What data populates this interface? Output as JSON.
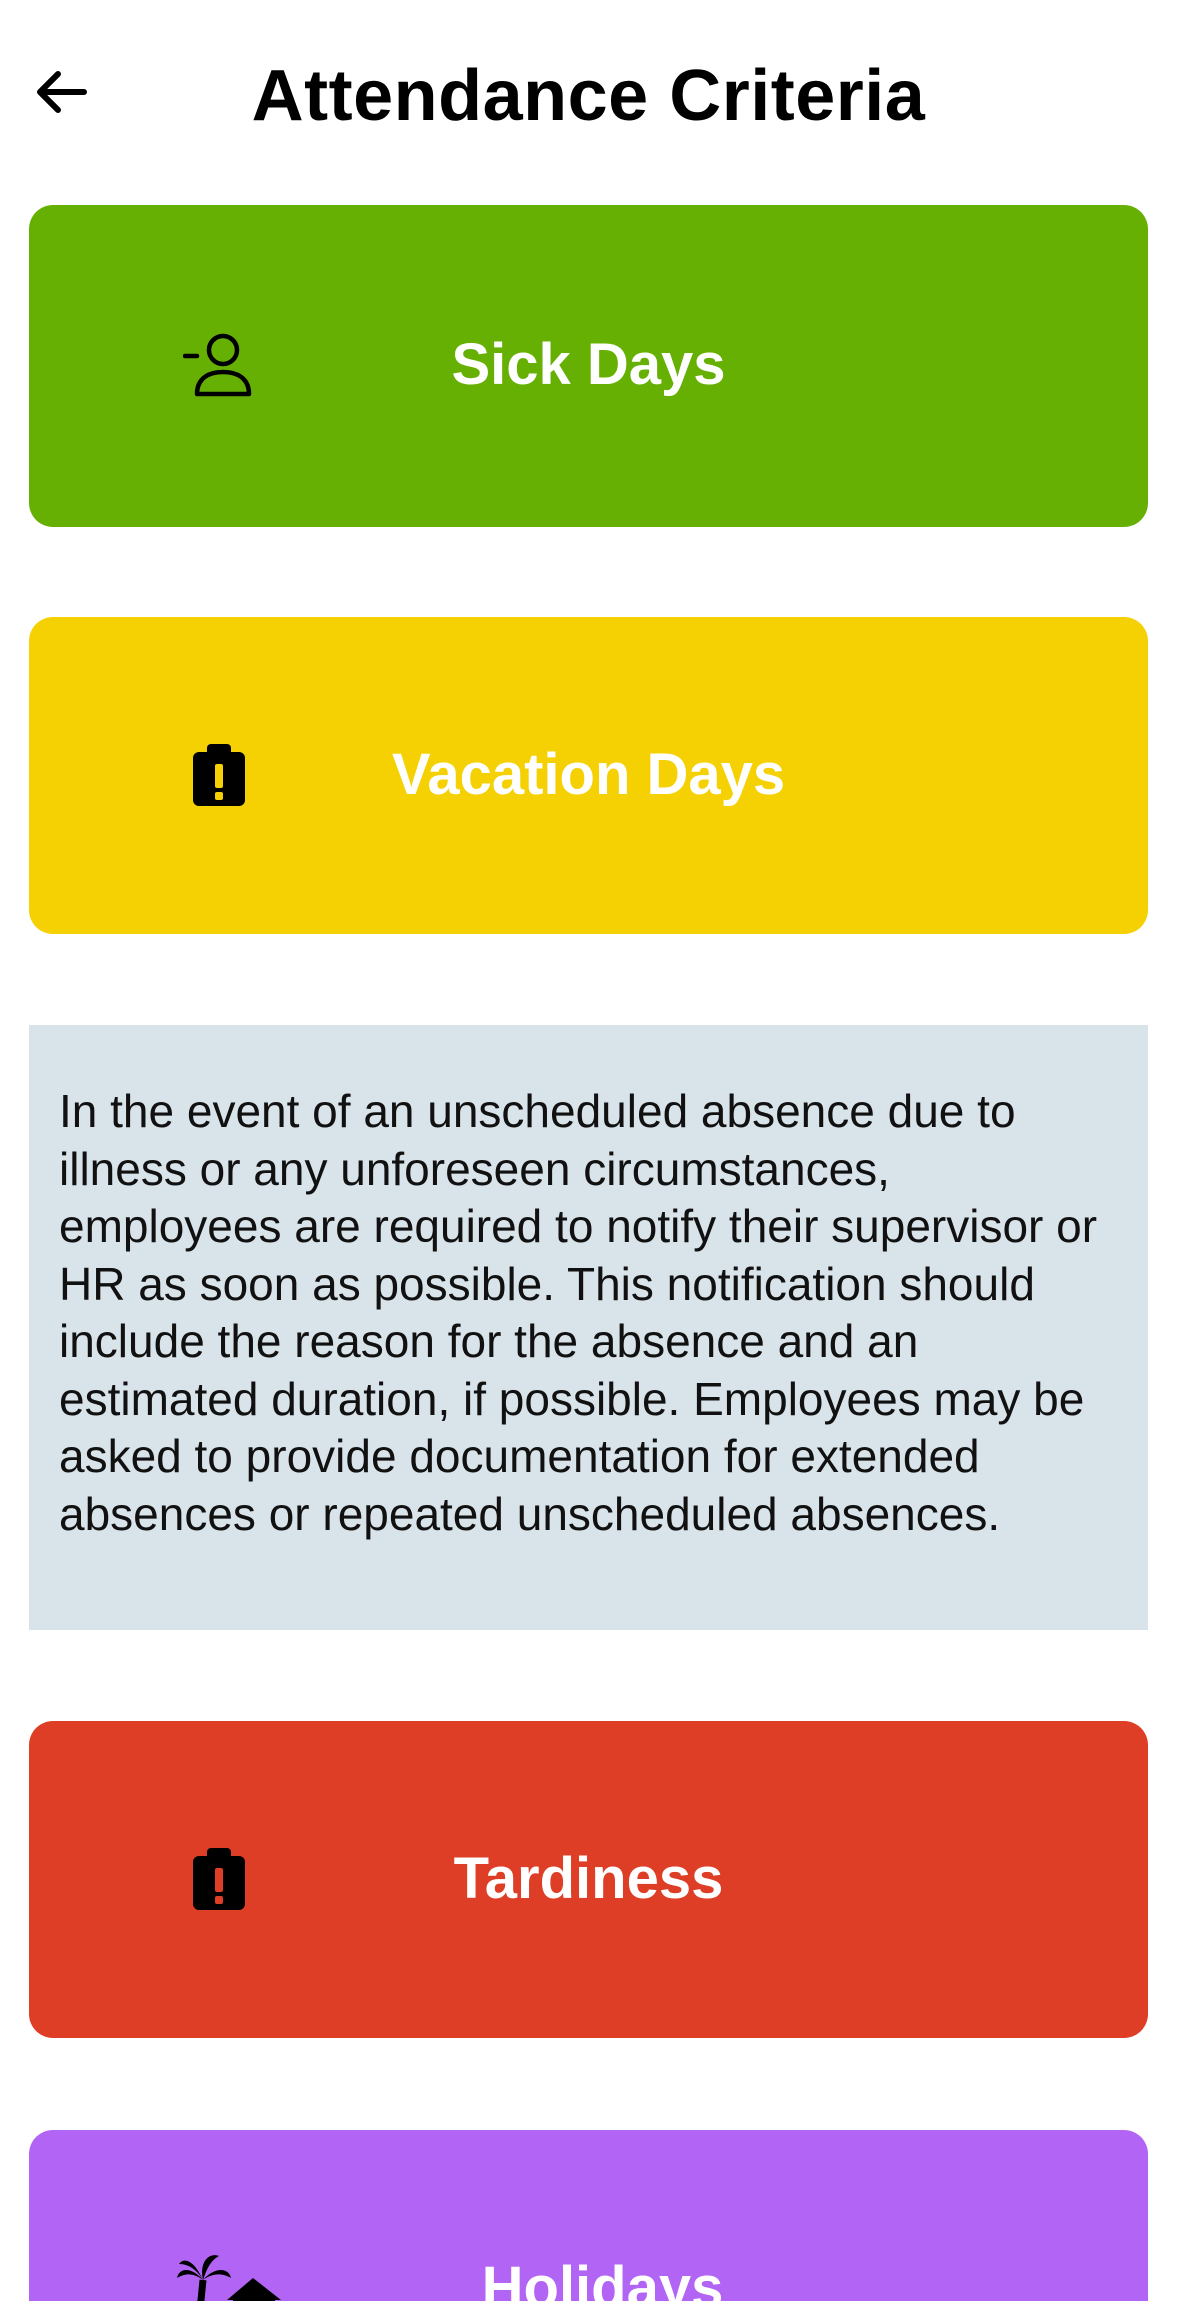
{
  "header": {
    "title": "Attendance Criteria",
    "back_icon": "arrow-left-icon"
  },
  "cards": [
    {
      "label": "Sick Days",
      "color": "#66b004",
      "icon": "person-minus-icon"
    },
    {
      "label": "Vacation Days",
      "color": "#f5d003",
      "icon": "clipboard-alert-icon"
    },
    {
      "label": "Tardiness",
      "color": "#dd3e25",
      "icon": "clipboard-alert-icon"
    },
    {
      "label": "Holidays",
      "color": "#b265f5",
      "icon": "palm-tree-house-icon"
    }
  ],
  "info": {
    "text": "In the event of an unscheduled absence due to illness or any unforeseen circumstances, employees are required to notify their supervisor or HR as soon as possible. This notification should include the reason for the absence and an estimated duration, if possible. Employees may be asked to provide documentation for extended absences or repeated unscheduled absences."
  }
}
